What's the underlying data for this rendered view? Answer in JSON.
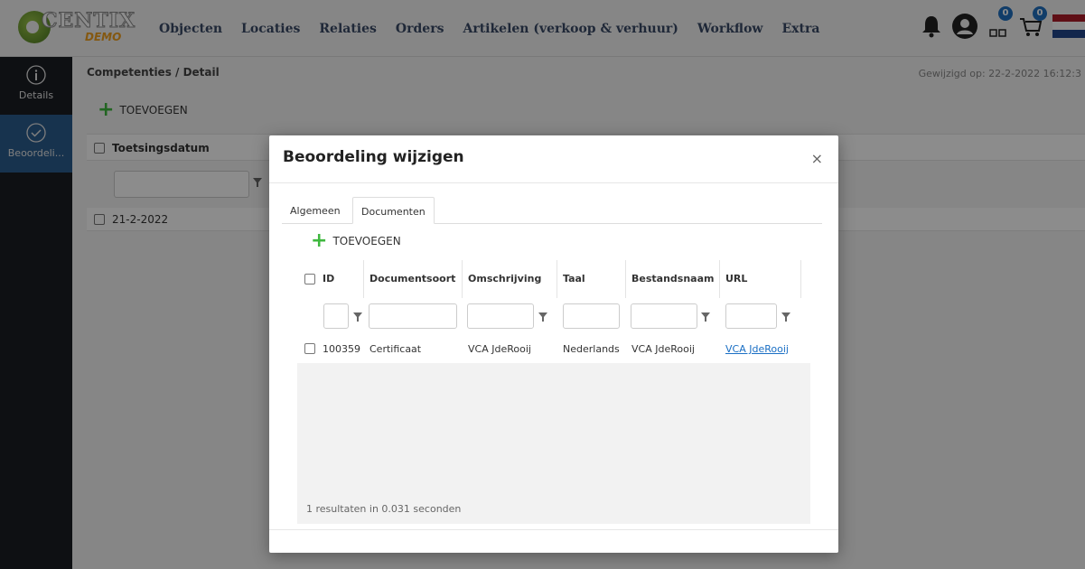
{
  "app": {
    "logo_text": "CENTIX",
    "logo_sub": "DEMO",
    "nav": [
      "Objecten",
      "Locaties",
      "Relaties",
      "Orders",
      "Artikelen (verkoop & verhuur)",
      "Workflow",
      "Extra"
    ],
    "badges": {
      "objects": "0",
      "cart": "0"
    },
    "icons": [
      "bell-icon",
      "user-icon",
      "grid-icon",
      "cart-icon",
      "flag-nl-icon"
    ]
  },
  "sidebar": {
    "items": [
      {
        "label": "Details",
        "icon": "info-icon",
        "active": false
      },
      {
        "label": "Beoordeli...",
        "icon": "check-circle-icon",
        "active": true
      }
    ]
  },
  "page": {
    "breadcrumb": "Competenties / Detail",
    "modified": "Gewijzigd op: 22-2-2022 16:12:3",
    "add_label": "TOEVOEGEN",
    "column": "Toetsingsdatum",
    "rows": [
      "21-2-2022"
    ]
  },
  "modal": {
    "title": "Beoordeling wijzigen",
    "close": "×",
    "tabs": [
      "Algemeen",
      "Documenten"
    ],
    "active_tab": "Documenten",
    "add_label": "TOEVOEGEN",
    "columns": [
      "ID",
      "Documentsoort",
      "Omschrijving",
      "Taal",
      "Bestandsnaam",
      "URL"
    ],
    "rows": [
      {
        "id": "100359",
        "documentsoort": "Certificaat",
        "omschrijving": "VCA JdeRooij",
        "taal": "Nederlands",
        "bestandsnaam": "VCA JdeRooij",
        "url": "VCA JdeRooij"
      }
    ],
    "footer": "1 resultaten in 0.031 seconden"
  },
  "colors": {
    "brand_blue": "#2b5d8e",
    "add_green": "#3fb83f",
    "link": "#1a6fc4",
    "sidebar": "#1b1e24"
  }
}
